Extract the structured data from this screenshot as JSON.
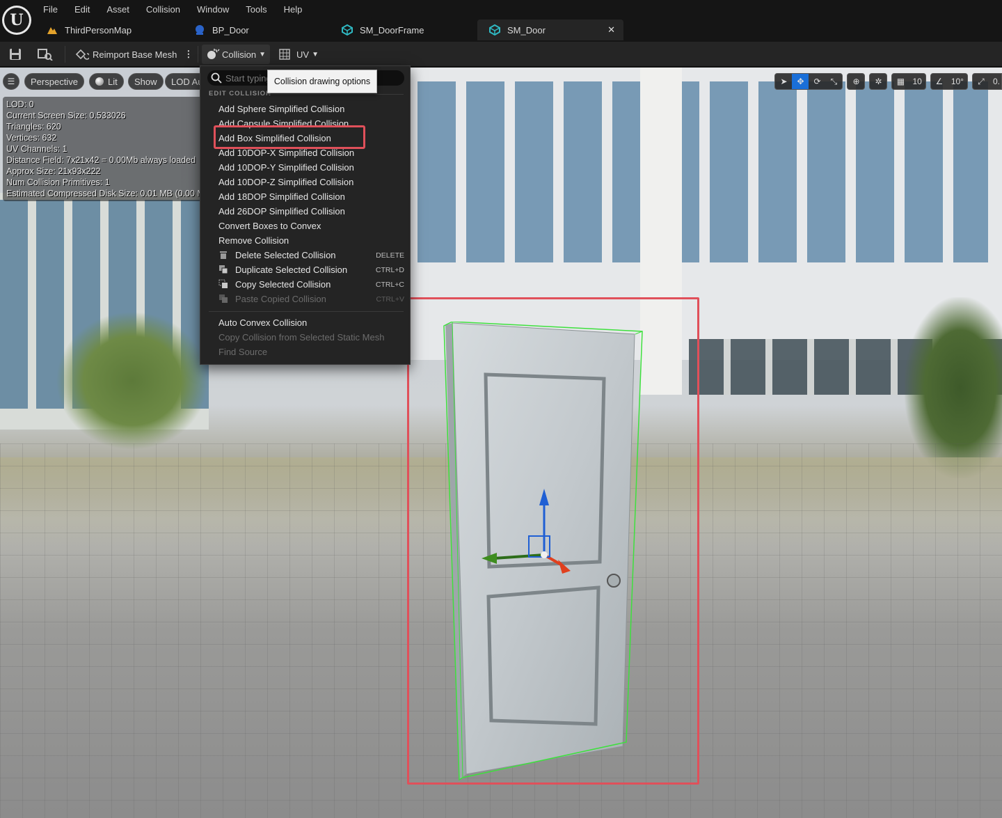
{
  "menu": [
    "File",
    "Edit",
    "Asset",
    "Collision",
    "Window",
    "Tools",
    "Help"
  ],
  "tabs": [
    {
      "label": "ThirdPersonMap",
      "icon": "map-icon"
    },
    {
      "label": "BP_Door",
      "icon": "blueprint-icon"
    },
    {
      "label": "SM_DoorFrame",
      "icon": "static-mesh-icon"
    },
    {
      "label": "SM_Door",
      "icon": "static-mesh-icon",
      "active": true
    }
  ],
  "toolbar": {
    "reimport_label": "Reimport Base Mesh",
    "collision_label": "Collision",
    "uv_label": "UV"
  },
  "viewport_bar": {
    "perspective": "Perspective",
    "lit": "Lit",
    "show": "Show",
    "lod": "LOD Au"
  },
  "stats": [
    "LOD:  0",
    "Current Screen Size:  0.533026",
    "Triangles:  620",
    "Vertices:  632",
    "UV Channels:  1",
    "Distance Field:  7x21x42 = 0.00Mb always loaded",
    "Approx Size: 21x93x222",
    "Num Collision Primitives:  1",
    "Estimated Compressed Disk Size: 0.01 MB (0.00 M"
  ],
  "widgets": {
    "grid_snap": "10",
    "rotation_snap": "10°",
    "scale_snap": "0."
  },
  "dropdown": {
    "search_placeholder": "Start typing",
    "section": "EDIT COLLISION",
    "tooltip": "Collision drawing options",
    "items": [
      {
        "label": "Add Sphere Simplified Collision"
      },
      {
        "label": "Add Capsule Simplified Collision"
      },
      {
        "label": "Add Box Simplified Collision"
      },
      {
        "label": "Add 10DOP-X Simplified Collision"
      },
      {
        "label": "Add 10DOP-Y Simplified Collision"
      },
      {
        "label": "Add 10DOP-Z Simplified Collision"
      },
      {
        "label": "Add 18DOP Simplified Collision"
      },
      {
        "label": "Add 26DOP Simplified Collision"
      },
      {
        "label": "Convert Boxes to Convex"
      },
      {
        "label": "Remove Collision"
      },
      {
        "label": "Delete Selected Collision",
        "shortcut": "DELETE",
        "icon": "trash-icon"
      },
      {
        "label": "Duplicate Selected Collision",
        "shortcut": "CTRL+D",
        "icon": "duplicate-icon"
      },
      {
        "label": "Copy Selected Collision",
        "shortcut": "CTRL+C",
        "icon": "copy-icon"
      },
      {
        "label": "Paste Copied Collision",
        "shortcut": "CTRL+V",
        "icon": "paste-icon",
        "disabled": true
      },
      {
        "label": "Auto Convex Collision"
      },
      {
        "label": "Copy Collision from Selected Static Mesh",
        "disabled": true
      },
      {
        "label": "Find Source",
        "disabled": true
      }
    ]
  },
  "colors": {
    "highlight": "#e0505a",
    "accent": "#1a6fd8",
    "collision_wire": "#3ee03e"
  }
}
